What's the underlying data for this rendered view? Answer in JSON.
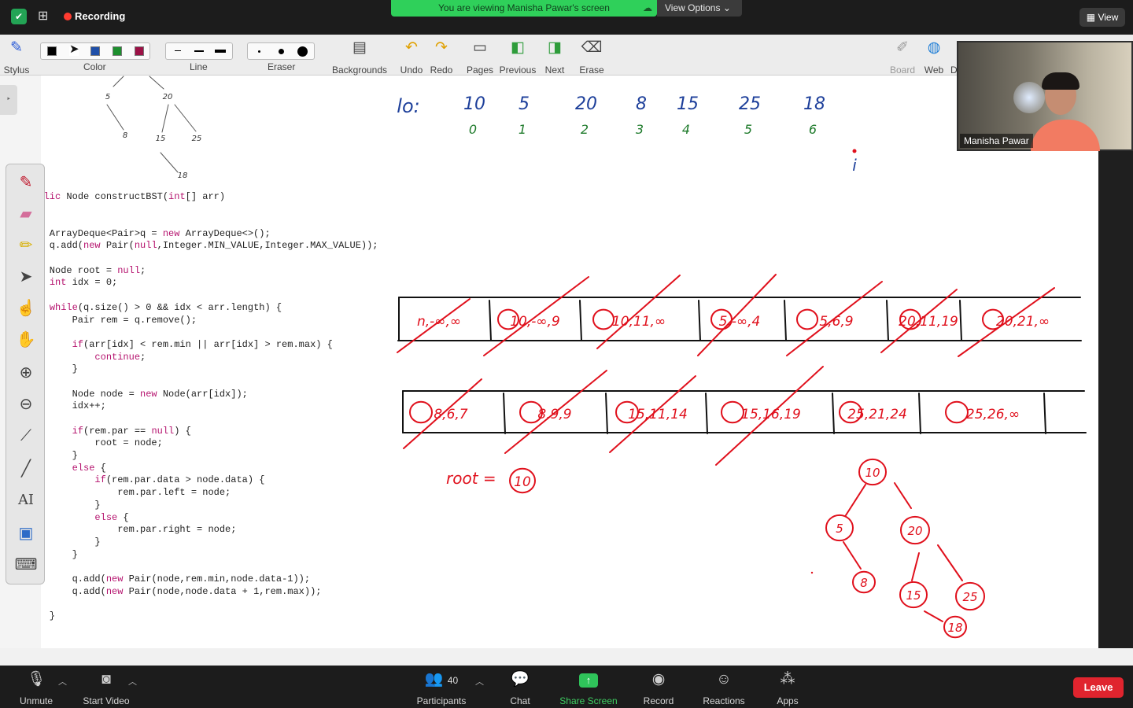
{
  "topbar": {
    "recording_label": "Recording",
    "viewing_banner": "You are viewing Manisha Pawar's screen",
    "view_options": "View Options",
    "view_button": "View"
  },
  "toolbar": {
    "stylus": "Stylus",
    "color": "Color",
    "line": "Line",
    "eraser": "Eraser",
    "backgrounds": "Backgrounds",
    "undo": "Undo",
    "redo": "Redo",
    "pages": "Pages",
    "previous": "Previous",
    "next": "Next",
    "erase": "Erase",
    "board": "Board",
    "web": "Web",
    "doc_partial": "D",
    "colors": [
      "#000000",
      "#1f4fa8",
      "#1d8f2e",
      "#9c1146"
    ]
  },
  "video": {
    "participant_name": "Manisha Pawar"
  },
  "code_lines": [
    "public Node constructBST(int[] arr)",
    "",
    "    ArrayDeque<Pair>q = new ArrayDeque<>();",
    "    q.add(new Pair(null,Integer.MIN_VALUE,Integer.MAX_VALUE));",
    "",
    "    Node root = null;",
    "    int idx = 0;",
    "",
    "    while(q.size() > 0 && idx < arr.length) {",
    "        Pair rem = q.remove();",
    "",
    "        if(arr[idx] < rem.min || arr[idx] > rem.max) {",
    "            continue;",
    "        }",
    "",
    "        Node node = new Node(arr[idx]);",
    "        idx++;",
    "",
    "        if(rem.par == null) {",
    "            root = node;",
    "        }",
    "        else {",
    "            if(rem.par.data > node.data) {",
    "                rem.par.left = node;",
    "            }",
    "            else {",
    "                rem.par.right = node;",
    "            }",
    "        }",
    "",
    "        q.add(new Pair(node,rem.min,node.data-1));",
    "        q.add(new Pair(node,node.data + 1,rem.max));",
    "",
    "    }"
  ],
  "board": {
    "array_label": "lo:",
    "array_values": [
      "10",
      "5",
      "20",
      "8",
      "15",
      "25",
      "18"
    ],
    "array_indices": [
      "0",
      "1",
      "2",
      "3",
      "4",
      "5",
      "6"
    ],
    "pointer_label": "i",
    "queue_row1": [
      "n,-∞,∞",
      "10,-∞,9",
      "10,11,∞",
      "5,-∞,4",
      "5,6,9",
      "20,11,19",
      "20,21,∞"
    ],
    "queue_row2": [
      "8,6,7",
      "8,9,9",
      "15,11,14",
      "15,16,19",
      "25,21,24",
      "25,26,∞"
    ],
    "root_label": "root =",
    "root_value": "10",
    "small_tree": [
      "5",
      "20",
      "8",
      "15",
      "25",
      "18"
    ],
    "big_tree": [
      "10",
      "5",
      "20",
      "8",
      "15",
      "25",
      "18"
    ]
  },
  "bottombar": {
    "unmute": "Unmute",
    "start_video": "Start Video",
    "participants": "Participants",
    "participant_count": "40",
    "chat": "Chat",
    "share_screen": "Share Screen",
    "record": "Record",
    "reactions": "Reactions",
    "apps": "Apps",
    "leave": "Leave"
  }
}
